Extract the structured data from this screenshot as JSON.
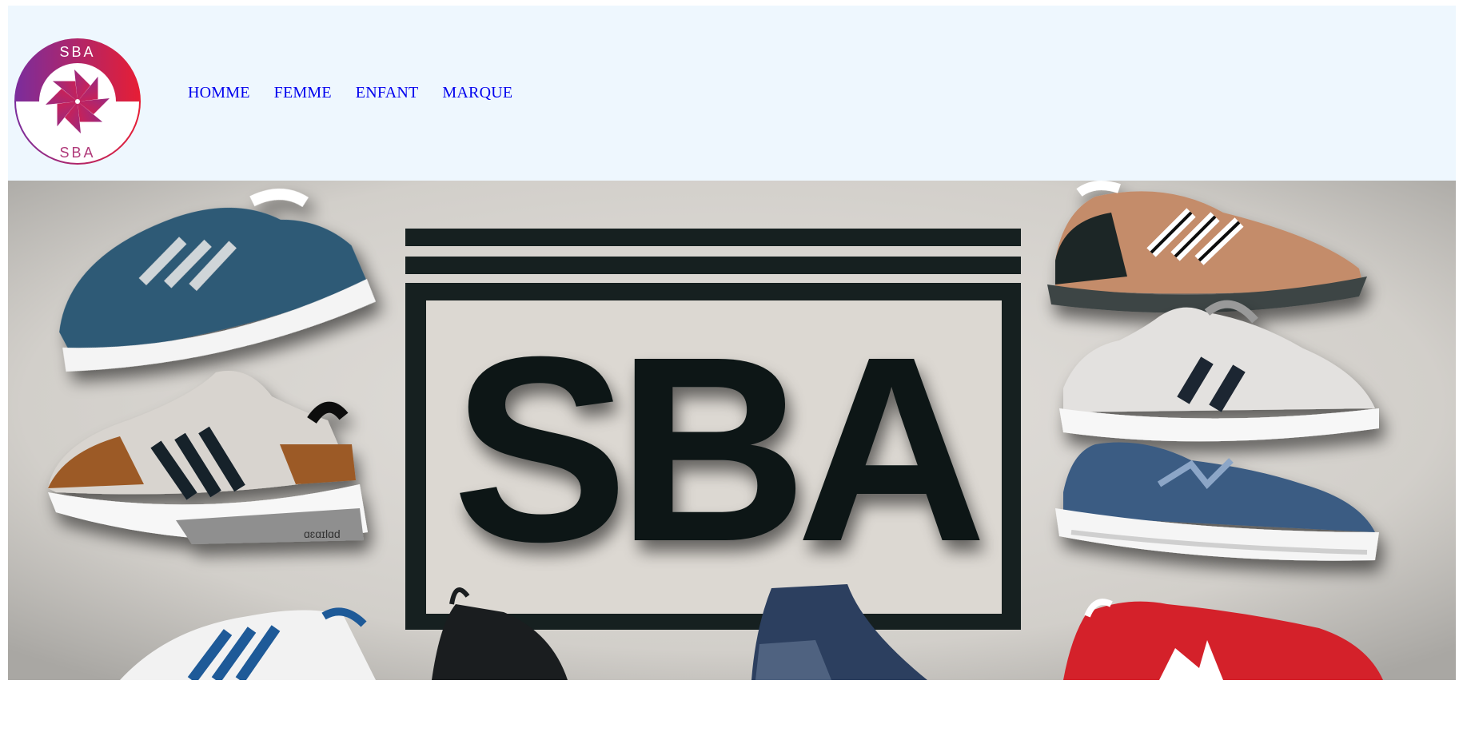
{
  "logo": {
    "top_text": "SBA",
    "bottom_text": "SBA",
    "icon": "pinwheel-icon",
    "gradient": [
      "#7b2d9c",
      "#e61e35"
    ]
  },
  "nav": {
    "items": [
      {
        "label": "HOMME"
      },
      {
        "label": "FEMME"
      },
      {
        "label": "ENFANT"
      },
      {
        "label": "MARQUE"
      }
    ]
  },
  "hero": {
    "brand": "SBA",
    "shoe_label": "ɑɛɑɪlɑd",
    "colors": {
      "header_bg": "#eef7fe",
      "link": "#0000ee",
      "hero_bg": "#d9d6d2",
      "letters": "#0b1414"
    }
  }
}
